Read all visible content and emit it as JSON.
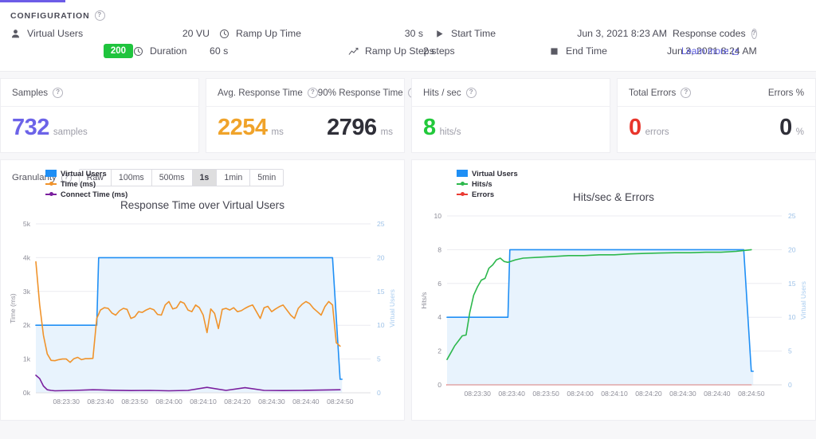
{
  "header": {
    "section_title": "CONFIGURATION",
    "help_icon": "help-circle-icon"
  },
  "config": {
    "rows": [
      {
        "icon": "user-icon",
        "label": "Virtual Users",
        "value": "20 VU"
      },
      {
        "icon": "clock-icon",
        "label": "Duration",
        "value": "60 s"
      }
    ],
    "rows2": [
      {
        "icon": "clock-icon",
        "label": "Ramp Up Time",
        "value": "30 s"
      },
      {
        "icon": "trend-up-icon",
        "label": "Ramp Up Steps",
        "value": "2 steps"
      }
    ],
    "rows3": [
      {
        "icon": "play-icon",
        "label": "Start Time",
        "value": "Jun 3, 2021 8:23 AM"
      },
      {
        "icon": "stop-icon",
        "label": "End Time",
        "value": "Jun 3, 2021 8:24 AM"
      }
    ],
    "response_codes": {
      "icon": "circle-filled-icon",
      "label": "Response codes",
      "learn_more": "Learn more",
      "learn_more_icon": "external-link-icon",
      "badge": "200",
      "badge_color": "#1fc43d"
    }
  },
  "kpis": [
    {
      "title": "Samples",
      "value": "732",
      "unit": "samples",
      "color": "#6c63e8"
    },
    {
      "title": "Avg. Response Time",
      "value": "2254",
      "unit": "ms",
      "color": "#f0a32a",
      "title2": "90% Response Time",
      "value2": "2796",
      "unit2": "ms",
      "color2": "#2f2f38"
    },
    {
      "title": "Hits / sec",
      "value": "8",
      "unit": "hits/s",
      "color": "#22c93b"
    },
    {
      "title": "Total Errors",
      "value": "0",
      "unit": "errors",
      "color": "#e8352b",
      "title2": "Errors %",
      "value2": "0",
      "unit2": "%",
      "color2": "#2f2f38"
    }
  ],
  "granularity": {
    "label": "Granularity",
    "options": [
      "Raw",
      "100ms",
      "500ms",
      "1s",
      "1min",
      "5min"
    ],
    "selected": "1s"
  },
  "chart_data": [
    {
      "type": "line",
      "title": "Response Time over Virtual Users",
      "xlabel": "",
      "ylabel": "Time (ms)",
      "ylabel_right": "Virtual Users",
      "ylim": [
        0,
        5000
      ],
      "ylim_right": [
        0,
        25
      ],
      "yticks": [
        "0k",
        "1k",
        "2k",
        "3k",
        "4k",
        "5k"
      ],
      "ytickvals": [
        0,
        1000,
        2000,
        3000,
        4000,
        5000
      ],
      "yticks_right": [
        "0",
        "5",
        "10",
        "15",
        "20",
        "25"
      ],
      "ytickvals_right": [
        0,
        5,
        10,
        15,
        20,
        25
      ],
      "xticks": [
        "08:23:30",
        "08:23:40",
        "08:23:50",
        "08:24:00",
        "08:24:10",
        "08:24:20",
        "08:24:30",
        "08:24:40",
        "08:24:50"
      ],
      "xlim": [
        0,
        88
      ],
      "grid": true,
      "legend_position": "top-left",
      "series": [
        {
          "name": "Virtual Users",
          "color": "#1f8ff5",
          "axis": "right",
          "fill": "#e8f3fd",
          "x": [
            0,
            16,
            16.5,
            78,
            80,
            80.5
          ],
          "values": [
            10,
            10,
            20,
            20,
            2,
            2
          ]
        },
        {
          "name": "Time (ms)",
          "color": "#f0932b",
          "axis": "left",
          "x": [
            0,
            1,
            2,
            3,
            4,
            5,
            6,
            7,
            8,
            9,
            10,
            11,
            12,
            13,
            14,
            15,
            16,
            17,
            18,
            19,
            20,
            21,
            22,
            23,
            24,
            25,
            26,
            27,
            28,
            29,
            30,
            31,
            32,
            33,
            34,
            35,
            36,
            37,
            38,
            39,
            40,
            41,
            42,
            43,
            44,
            45,
            46,
            47,
            48,
            49,
            50,
            51,
            52,
            53,
            54,
            55,
            56,
            57,
            58,
            59,
            60,
            61,
            62,
            63,
            64,
            65,
            66,
            67,
            68,
            69,
            70,
            71,
            72,
            73,
            74,
            75,
            76,
            77,
            78,
            79,
            80
          ],
          "values": [
            3880,
            2600,
            1700,
            1150,
            960,
            950,
            980,
            1000,
            1000,
            900,
            1010,
            1050,
            980,
            1010,
            1010,
            1020,
            2200,
            2450,
            2520,
            2500,
            2360,
            2300,
            2430,
            2500,
            2470,
            2200,
            2250,
            2400,
            2380,
            2450,
            2500,
            2460,
            2320,
            2300,
            2600,
            2700,
            2480,
            2520,
            2700,
            2650,
            2450,
            2400,
            2600,
            2520,
            2300,
            1780,
            2480,
            2350,
            1900,
            2470,
            2500,
            2450,
            2520,
            2400,
            2430,
            2500,
            2560,
            2600,
            2400,
            2200,
            2520,
            2560,
            2400,
            2480,
            2550,
            2600,
            2450,
            2300,
            2200,
            2500,
            2620,
            2700,
            2640,
            2500,
            2400,
            2300,
            2550,
            2700,
            2600,
            1480,
            1380
          ]
        },
        {
          "name": "Connect Time (ms)",
          "color": "#7a1f9e",
          "axis": "left",
          "x": [
            0,
            1,
            2,
            3,
            4,
            5,
            10,
            15,
            20,
            25,
            30,
            35,
            40,
            45,
            50,
            55,
            60,
            65,
            70,
            75,
            80
          ],
          "values": [
            520,
            420,
            200,
            90,
            70,
            60,
            70,
            90,
            75,
            65,
            70,
            60,
            70,
            160,
            70,
            150,
            70,
            65,
            70,
            80,
            90
          ]
        }
      ]
    },
    {
      "type": "line",
      "title": "Hits/sec & Errors",
      "xlabel": "",
      "ylabel": "Hits/s",
      "ylabel_right": "Virtual Users",
      "ylim": [
        0,
        10
      ],
      "ylim_right": [
        0,
        25
      ],
      "yticks": [
        "0",
        "2",
        "4",
        "6",
        "8",
        "10"
      ],
      "ytickvals": [
        0,
        2,
        4,
        6,
        8,
        10
      ],
      "yticks_right": [
        "0",
        "5",
        "10",
        "15",
        "20",
        "25"
      ],
      "ytickvals_right": [
        0,
        5,
        10,
        15,
        20,
        25
      ],
      "xticks": [
        "08:23:30",
        "08:23:40",
        "08:23:50",
        "08:24:00",
        "08:24:10",
        "08:24:20",
        "08:24:30",
        "08:24:40",
        "08:24:50"
      ],
      "xlim": [
        0,
        88
      ],
      "grid": true,
      "legend_position": "top-left",
      "series": [
        {
          "name": "Virtual Users",
          "color": "#1f8ff5",
          "axis": "right",
          "fill": "#e8f3fd",
          "x": [
            0,
            16,
            16.5,
            78,
            80,
            80.5
          ],
          "values": [
            10,
            10,
            20,
            20,
            2,
            2
          ]
        },
        {
          "name": "Hits/s",
          "color": "#2db84d",
          "axis": "left",
          "x": [
            0,
            1,
            2,
            3,
            4,
            5,
            6,
            7,
            8,
            9,
            10,
            11,
            12,
            13,
            14,
            15,
            16,
            18,
            20,
            24,
            28,
            32,
            36,
            40,
            44,
            48,
            52,
            56,
            60,
            64,
            68,
            72,
            76,
            80
          ],
          "values": [
            1.5,
            1.9,
            2.3,
            2.6,
            2.9,
            2.95,
            4.3,
            5.3,
            5.8,
            6.2,
            6.3,
            6.9,
            7.1,
            7.4,
            7.5,
            7.3,
            7.25,
            7.4,
            7.5,
            7.55,
            7.6,
            7.65,
            7.65,
            7.7,
            7.7,
            7.75,
            7.78,
            7.8,
            7.82,
            7.82,
            7.85,
            7.85,
            7.9,
            8.0
          ]
        },
        {
          "name": "Errors",
          "color": "#ea3b33",
          "axis": "left",
          "x": [
            0,
            80
          ],
          "values": [
            0,
            0
          ]
        }
      ]
    }
  ]
}
